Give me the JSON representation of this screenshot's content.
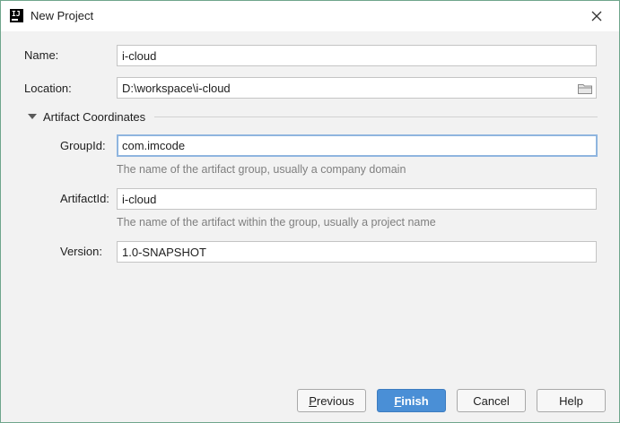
{
  "window": {
    "title": "New Project",
    "app_icon_text": "IJ"
  },
  "form": {
    "name_label": "Name:",
    "name_value": "i-cloud",
    "location_label": "Location:",
    "location_value": "D:\\workspace\\i-cloud",
    "section_title": "Artifact Coordinates",
    "groupid_label": "GroupId:",
    "groupid_value": "com.imcode",
    "groupid_hint": "The name of the artifact group, usually a company domain",
    "artifactid_label": "ArtifactId:",
    "artifactid_value": "i-cloud",
    "artifactid_hint": "The name of the artifact within the group, usually a project name",
    "version_label": "Version:",
    "version_value": "1.0-SNAPSHOT"
  },
  "buttons": {
    "previous_mnemonic": "P",
    "previous_rest": "revious",
    "finish_mnemonic": "F",
    "finish_rest": "inish",
    "cancel": "Cancel",
    "help": "Help"
  },
  "icons": {
    "app": "intellij-icon",
    "close": "close-icon",
    "folder": "folder-icon",
    "collapse": "triangle-down-icon"
  },
  "colors": {
    "accent": "#4a8fd6",
    "focus_border": "#8fb5df",
    "hint_text": "#7f7f7f",
    "window_border": "#6fa58c"
  }
}
